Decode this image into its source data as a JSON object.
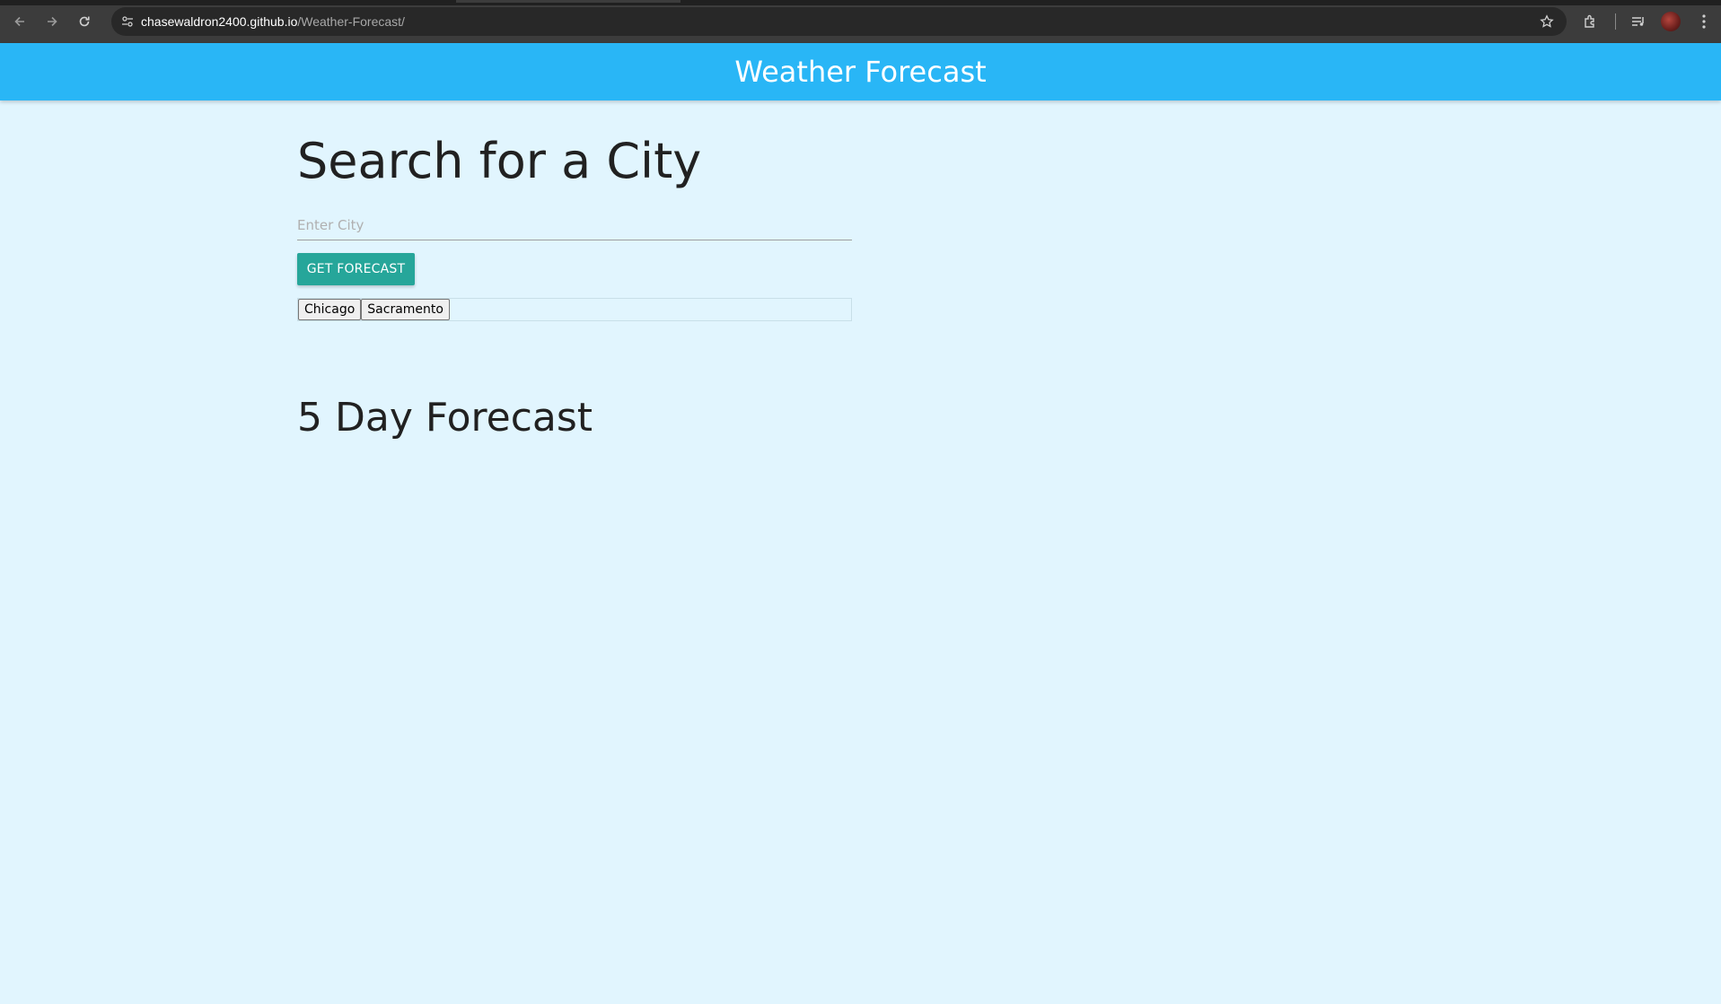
{
  "browser": {
    "url_host": "chasewaldron2400.github.io",
    "url_path": "/Weather-Forecast/"
  },
  "header": {
    "title": "Weather Forecast",
    "bg_color": "#29b6f6"
  },
  "search": {
    "heading": "Search for a City",
    "input_placeholder": "Enter City",
    "input_value": "",
    "button_label": "GET FORECAST",
    "button_color": "#26a69a"
  },
  "history": {
    "items": [
      "Chicago",
      "Sacramento"
    ]
  },
  "forecast": {
    "heading": "5 Day Forecast"
  },
  "page": {
    "bg_color": "#e1f5fe"
  }
}
